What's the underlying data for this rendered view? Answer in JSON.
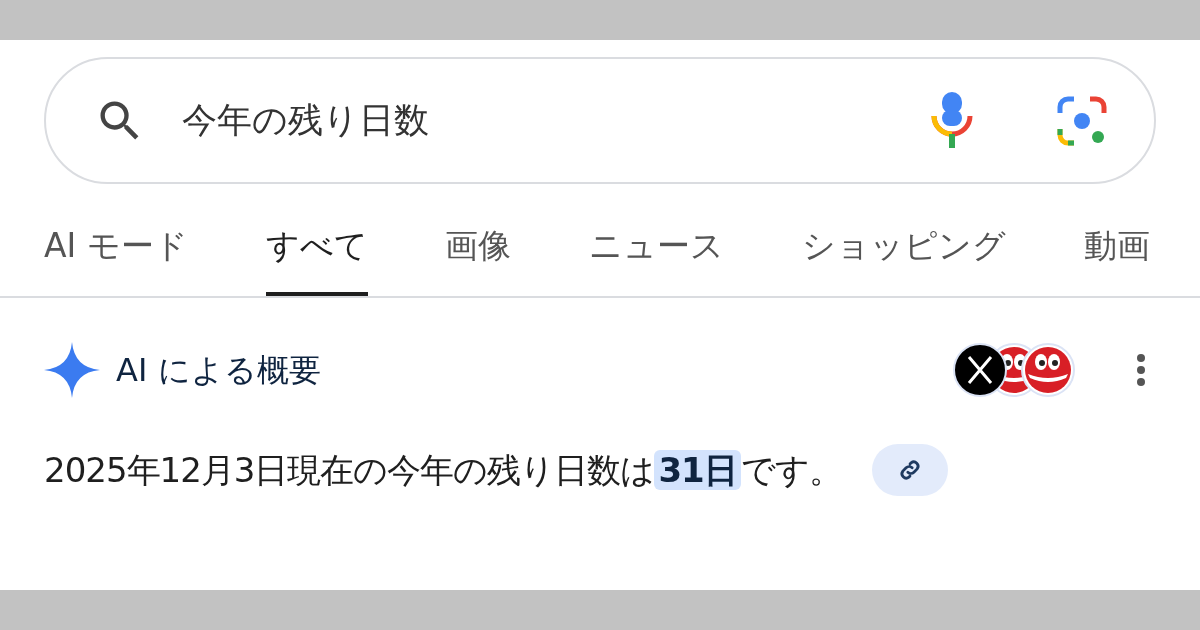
{
  "search": {
    "value": "今年の残り日数"
  },
  "tabs": [
    {
      "label": "AI モード",
      "selected": false
    },
    {
      "label": "すべて",
      "selected": true
    },
    {
      "label": "画像",
      "selected": false
    },
    {
      "label": "ニュース",
      "selected": false
    },
    {
      "label": "ショッピング",
      "selected": false
    },
    {
      "label": "動画",
      "selected": false
    }
  ],
  "ai_overview": {
    "title": "AI による概要",
    "answer": {
      "before": "2025年12月3日現在の今年の残り日数は",
      "highlight": "31日",
      "after": "です。"
    }
  }
}
